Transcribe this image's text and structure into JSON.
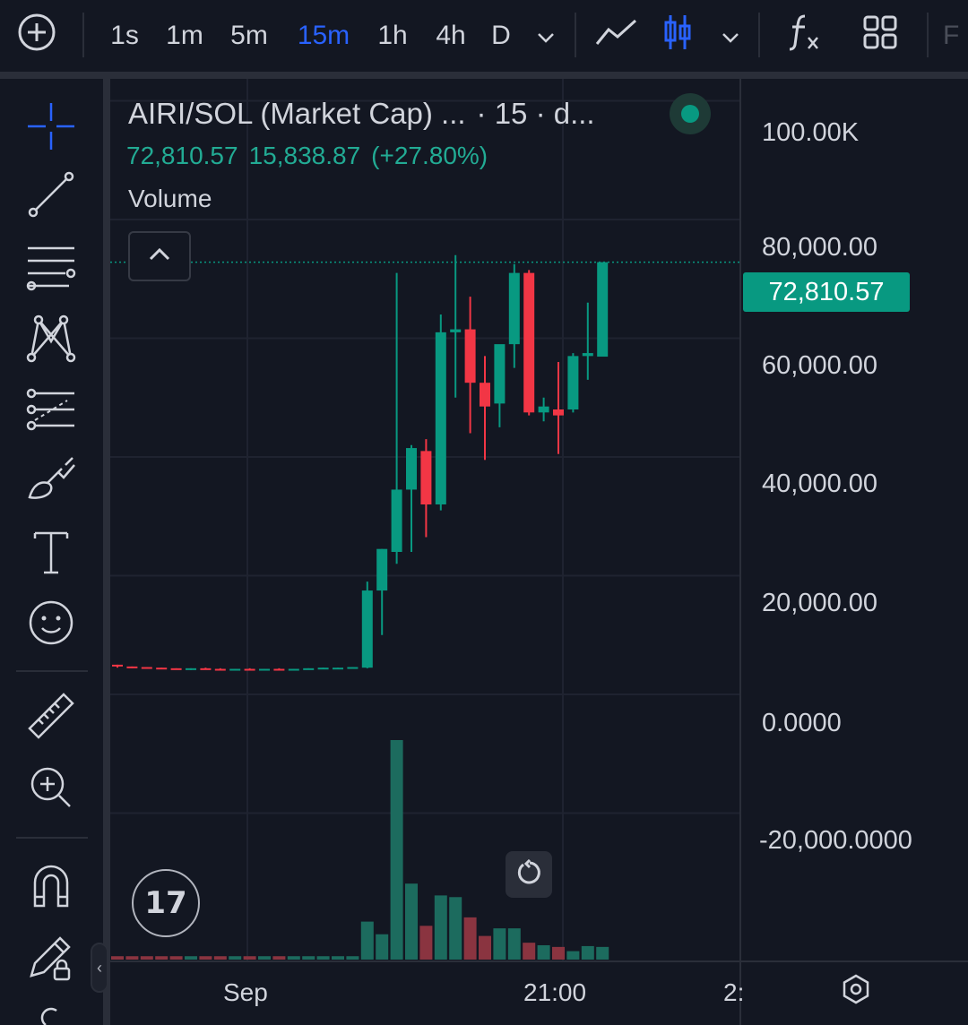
{
  "toolbar": {
    "intervals": [
      "1s",
      "1m",
      "5m",
      "15m",
      "1h",
      "4h",
      "D"
    ],
    "active_interval": "15m",
    "accent_color": "#2962ff"
  },
  "legend": {
    "symbol": "AIRI/SOL (Market Cap) ...",
    "resolution": "· 15 · d...",
    "last": "72,810.57",
    "change": "15,838.87",
    "change_pct": "(+27.80%)",
    "volume_label": "Volume",
    "status_color": "#089981"
  },
  "price_axis": {
    "labels": [
      "100.00K",
      "80,000.00",
      "60,000.00",
      "40,000.00",
      "20,000.00",
      "0.0000",
      "-20,000.0000"
    ],
    "last_price": "72,810.57"
  },
  "time_axis": {
    "labels": [
      "Sep",
      "21:00",
      "2:"
    ]
  },
  "colors": {
    "background": "#131722",
    "up": "#089981",
    "down": "#f23645",
    "volume_up": "#1c6b5e",
    "volume_down": "#8a3440"
  },
  "chart_data": {
    "type": "candlestick",
    "ylim": [
      -20000,
      100000
    ],
    "candles": [
      {
        "o": 5000,
        "h": 5000,
        "l": 4500,
        "c": 4700,
        "v": 400
      },
      {
        "o": 4700,
        "h": 4700,
        "l": 4400,
        "c": 4600,
        "v": 400
      },
      {
        "o": 4600,
        "h": 4600,
        "l": 4300,
        "c": 4500,
        "v": 400
      },
      {
        "o": 4500,
        "h": 4500,
        "l": 4300,
        "c": 4400,
        "v": 400
      },
      {
        "o": 4400,
        "h": 4400,
        "l": 4200,
        "c": 4300,
        "v": 400
      },
      {
        "o": 4300,
        "h": 4400,
        "l": 4100,
        "c": 4400,
        "v": 400
      },
      {
        "o": 4400,
        "h": 4500,
        "l": 4200,
        "c": 4300,
        "v": 400
      },
      {
        "o": 4300,
        "h": 4400,
        "l": 4100,
        "c": 4200,
        "v": 400
      },
      {
        "o": 4200,
        "h": 4300,
        "l": 4100,
        "c": 4300,
        "v": 400
      },
      {
        "o": 4300,
        "h": 4400,
        "l": 4200,
        "c": 4200,
        "v": 400
      },
      {
        "o": 4200,
        "h": 4300,
        "l": 4100,
        "c": 4300,
        "v": 400
      },
      {
        "o": 4300,
        "h": 4400,
        "l": 4200,
        "c": 4200,
        "v": 400
      },
      {
        "o": 4200,
        "h": 4300,
        "l": 4200,
        "c": 4300,
        "v": 400
      },
      {
        "o": 4300,
        "h": 4400,
        "l": 4200,
        "c": 4400,
        "v": 400
      },
      {
        "o": 4400,
        "h": 4500,
        "l": 4300,
        "c": 4500,
        "v": 400
      },
      {
        "o": 4500,
        "h": 4500,
        "l": 4400,
        "c": 4500,
        "v": 400
      },
      {
        "o": 4500,
        "h": 4600,
        "l": 4400,
        "c": 4600,
        "v": 400
      },
      {
        "o": 4500,
        "h": 19000,
        "l": 4400,
        "c": 17500,
        "v": 4500
      },
      {
        "o": 17500,
        "h": 24500,
        "l": 10000,
        "c": 24500,
        "v": 3000
      },
      {
        "o": 24000,
        "h": 71000,
        "l": 22000,
        "c": 34500,
        "v": 26000
      },
      {
        "o": 34500,
        "h": 42000,
        "l": 24000,
        "c": 41500,
        "v": 9000
      },
      {
        "o": 41000,
        "h": 43000,
        "l": 26500,
        "c": 32000,
        "v": 4000
      },
      {
        "o": 32000,
        "h": 64000,
        "l": 31000,
        "c": 61000,
        "v": 7600
      },
      {
        "o": 61000,
        "h": 74000,
        "l": 50000,
        "c": 61500,
        "v": 7400
      },
      {
        "o": 61500,
        "h": 67000,
        "l": 44000,
        "c": 52500,
        "v": 5000
      },
      {
        "o": 52500,
        "h": 57000,
        "l": 39500,
        "c": 48500,
        "v": 2800
      },
      {
        "o": 49000,
        "h": 57000,
        "l": 45000,
        "c": 59000,
        "v": 3700
      },
      {
        "o": 59000,
        "h": 72500,
        "l": 55000,
        "c": 71000,
        "v": 3700
      },
      {
        "o": 71000,
        "h": 71500,
        "l": 47000,
        "c": 47500,
        "v": 2000
      },
      {
        "o": 47500,
        "h": 50000,
        "l": 46000,
        "c": 48500,
        "v": 1700
      },
      {
        "o": 48000,
        "h": 56000,
        "l": 40500,
        "c": 47000,
        "v": 1500
      },
      {
        "o": 48000,
        "h": 57500,
        "l": 47500,
        "c": 57000,
        "v": 1000
      },
      {
        "o": 57000,
        "h": 66000,
        "l": 53000,
        "c": 57500,
        "v": 1600
      },
      {
        "o": 56900,
        "h": 72800,
        "l": 56900,
        "c": 72810.57,
        "v": 1500
      }
    ]
  }
}
